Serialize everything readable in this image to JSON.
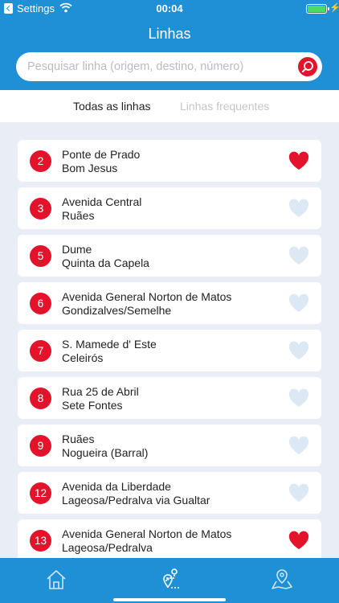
{
  "status": {
    "app": "Settings",
    "time": "00:04"
  },
  "header": {
    "title": "Linhas"
  },
  "search": {
    "placeholder": "Pesquisar linha (origem, destino, número)"
  },
  "tabs": {
    "all": "Todas as linhas",
    "frequent": "Linhas frequentes"
  },
  "colors": {
    "primary": "#1f8fd6",
    "accent": "#e3132b",
    "favorite": "#e3132b",
    "not_favorite": "#dde8f5"
  },
  "lines": [
    {
      "number": "2",
      "origin": "Ponte de Prado",
      "destination": "Bom Jesus",
      "favorite": true
    },
    {
      "number": "3",
      "origin": "Avenida Central",
      "destination": "Ruães",
      "favorite": false
    },
    {
      "number": "5",
      "origin": "Dume",
      "destination": "Quinta da Capela",
      "favorite": false
    },
    {
      "number": "6",
      "origin": "Avenida General Norton de Matos",
      "destination": "Gondizalves/Semelhe",
      "favorite": false
    },
    {
      "number": "7",
      "origin": "S. Mamede d' Este",
      "destination": "Celeirós",
      "favorite": false
    },
    {
      "number": "8",
      "origin": "Rua 25 de Abril",
      "destination": "Sete Fontes",
      "favorite": false
    },
    {
      "number": "9",
      "origin": "Ruães",
      "destination": "Nogueira (Barral)",
      "favorite": false
    },
    {
      "number": "12",
      "origin": "Avenida da Liberdade",
      "destination": "Lageosa/Pedralva via Gualtar",
      "favorite": false
    },
    {
      "number": "13",
      "origin": "Avenida General Norton de Matos",
      "destination": "Lageosa/Pedralva",
      "favorite": true
    }
  ],
  "tabbar": {
    "items": [
      "home-icon",
      "route-icon",
      "map-pin-icon"
    ],
    "active": 1
  }
}
